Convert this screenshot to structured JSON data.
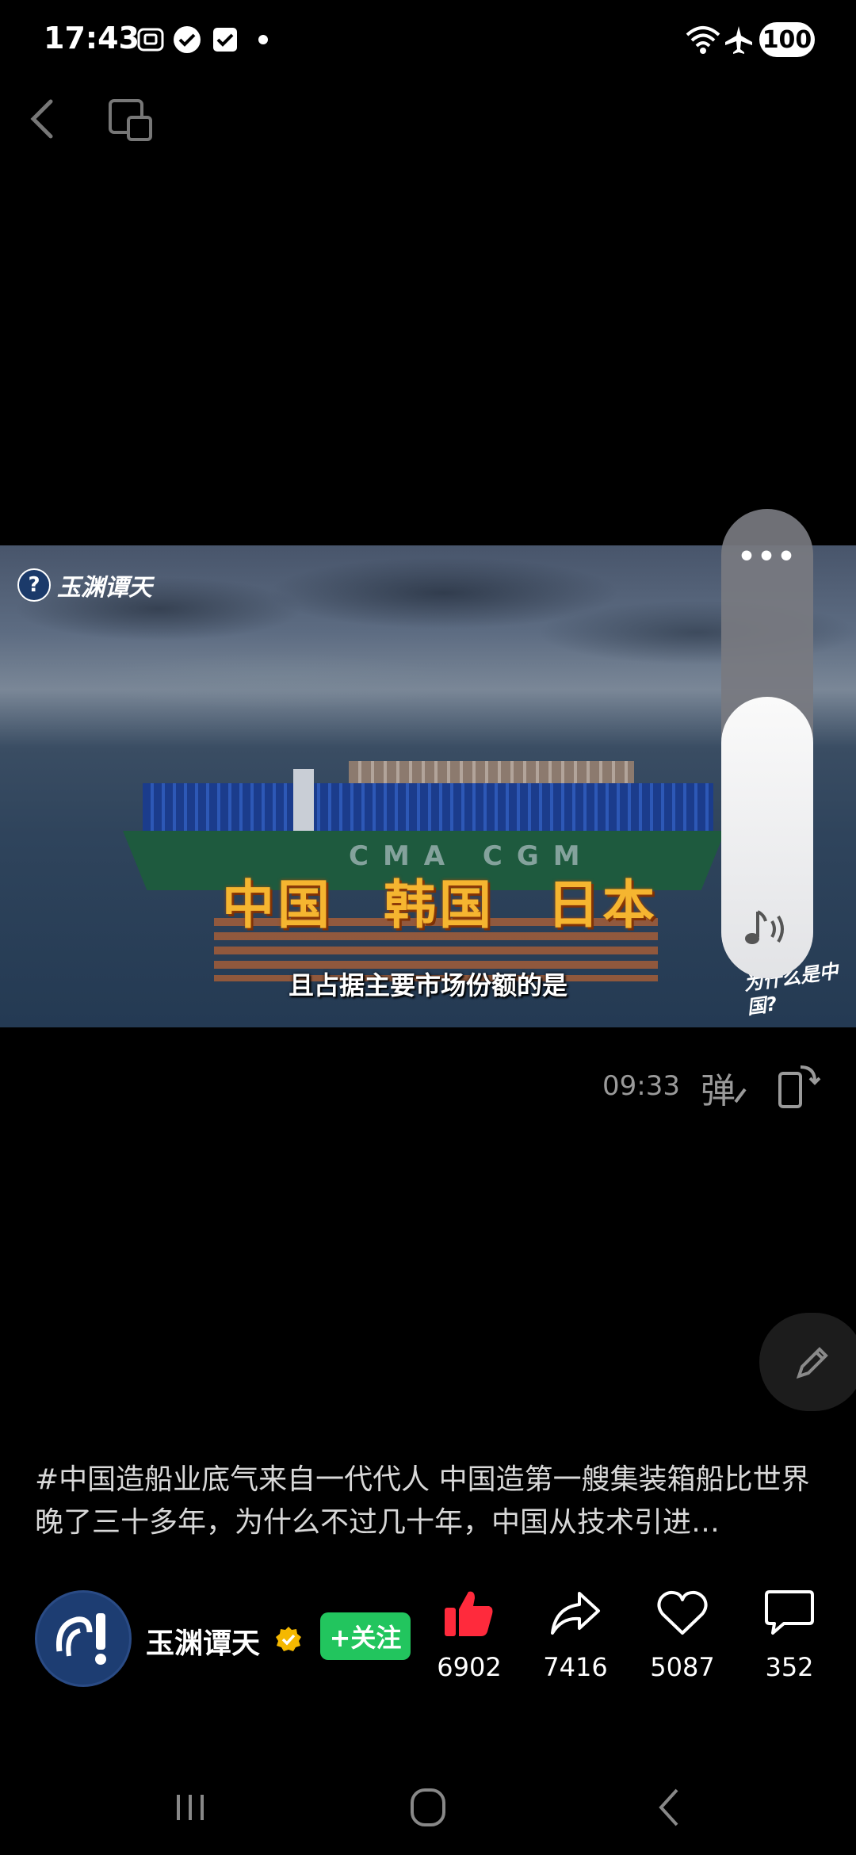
{
  "status_bar": {
    "time": "17:43",
    "battery": "100",
    "icons": [
      "screenshot-icon",
      "check-badge-icon",
      "checkbox-icon",
      "dot-icon",
      "wifi-icon",
      "airplane-icon"
    ]
  },
  "video": {
    "watermark": "玉渊谭天",
    "watermark_br": "为什么是中国?",
    "ship_name": "CMA CGM",
    "overlay_countries": [
      "中国",
      "韩国",
      "日本"
    ],
    "subtitle": "且占据主要市场份额的是"
  },
  "volume_slider": {
    "more": "•••",
    "level": 0.6
  },
  "controls": {
    "duration": "09:33",
    "danmaku": "弹"
  },
  "caption": "#中国造船业底气来自一代代人 中国造第一艘集装箱船比世界晚了三十多年，为什么不过几十年，中国从技术引进…",
  "author": {
    "name": "玉渊谭天",
    "follow_label": "+关注"
  },
  "actions": {
    "likes": "6902",
    "shares": "7416",
    "favorites": "5087",
    "comments": "352"
  },
  "colors": {
    "like": "#ff2a3c",
    "follow": "#22c55e",
    "verified": "#f5b800"
  }
}
